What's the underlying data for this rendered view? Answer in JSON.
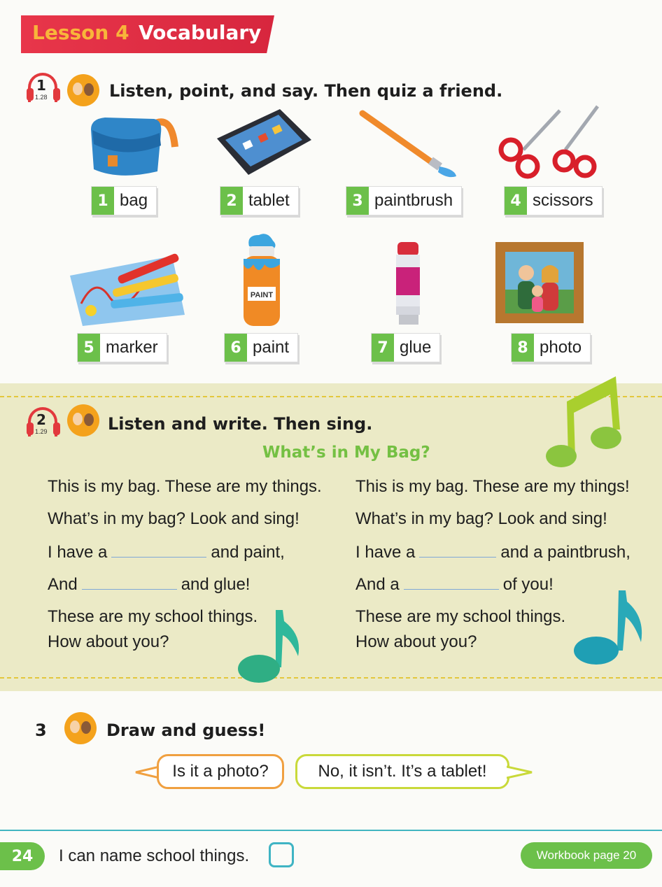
{
  "header": {
    "lesson": "Lesson 4",
    "title": "Vocabulary"
  },
  "activity1": {
    "track": {
      "number": "1",
      "code": "1.28"
    },
    "instruction": "Listen, point, and say. Then quiz a friend.",
    "items": [
      {
        "num": "1",
        "word": "bag",
        "icon": "bag-icon"
      },
      {
        "num": "2",
        "word": "tablet",
        "icon": "tablet-icon"
      },
      {
        "num": "3",
        "word": "paintbrush",
        "icon": "paintbrush-icon"
      },
      {
        "num": "4",
        "word": "scissors",
        "icon": "scissors-icon"
      },
      {
        "num": "5",
        "word": "marker",
        "icon": "marker-icon"
      },
      {
        "num": "6",
        "word": "paint",
        "icon": "paint-icon"
      },
      {
        "num": "7",
        "word": "glue",
        "icon": "glue-icon"
      },
      {
        "num": "8",
        "word": "photo",
        "icon": "photo-icon"
      }
    ]
  },
  "activity2": {
    "track": {
      "number": "2",
      "code": "1.29"
    },
    "instruction": "Listen and write. Then sing.",
    "song_title": "What’s in My Bag?",
    "left_verse": {
      "line1": "This is my bag. These are my things.",
      "line2": "What’s in my bag? Look and sing!",
      "line3a": "I have a",
      "line3b": "and paint,",
      "line4a": "And",
      "line4b": "and glue!",
      "line5": "These are my school things.",
      "line6": "How about you?"
    },
    "right_verse": {
      "line1": "This is my bag. These are my things!",
      "line2": "What’s in my bag? Look and sing!",
      "line3a": "I have a",
      "line3b": "and a paintbrush,",
      "line4a": "And a",
      "line4b": "of you!",
      "line5": "These are my school things.",
      "line6": "How about you?"
    }
  },
  "activity3": {
    "number": "3",
    "instruction": "Draw and guess!",
    "bubble_question": "Is it a photo?",
    "bubble_answer": "No, it isn’t. It’s a tablet!"
  },
  "footer": {
    "page_number": "24",
    "can_do": "I can name school things.",
    "workbook": "Workbook page 20"
  },
  "colors": {
    "banner_red": "#d7263e",
    "lesson_orange": "#f8b53a",
    "label_green": "#6cc04a",
    "song_bg": "#ebeac6",
    "song_title_green": "#74c043",
    "footer_teal": "#41b5c1"
  }
}
